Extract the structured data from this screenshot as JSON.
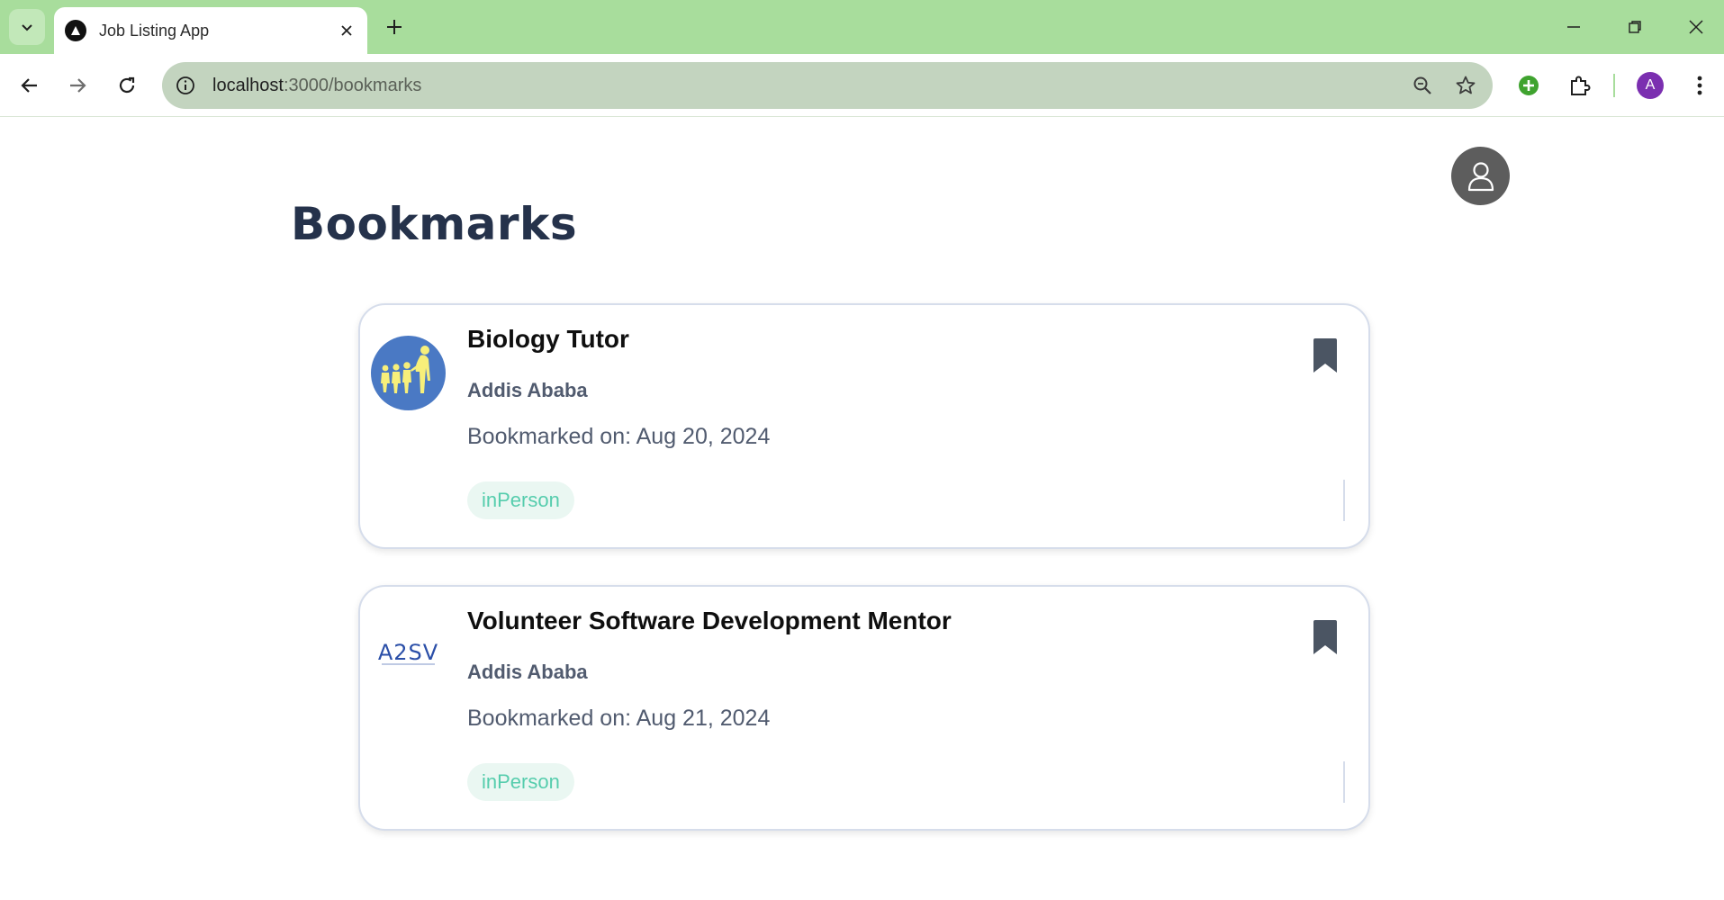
{
  "browser": {
    "tab_title": "Job Listing App",
    "url_host": "localhost",
    "url_path": ":3000/bookmarks",
    "profile_initial": "A",
    "accent": "#a8dd9c"
  },
  "page": {
    "title": "Bookmarks"
  },
  "bookmarks": [
    {
      "title": "Biology Tutor",
      "company": "Addis Ababa",
      "date": "Bookmarked on: Aug 20, 2024",
      "tag": "inPerson",
      "logo": "children-silhouette-logo"
    },
    {
      "title": "Volunteer Software Development Mentor",
      "company": "Addis Ababa",
      "date": "Bookmarked on: Aug 21, 2024",
      "tag": "inPerson",
      "logo": "a2sv-logo",
      "logo_text": "A2SV"
    }
  ]
}
